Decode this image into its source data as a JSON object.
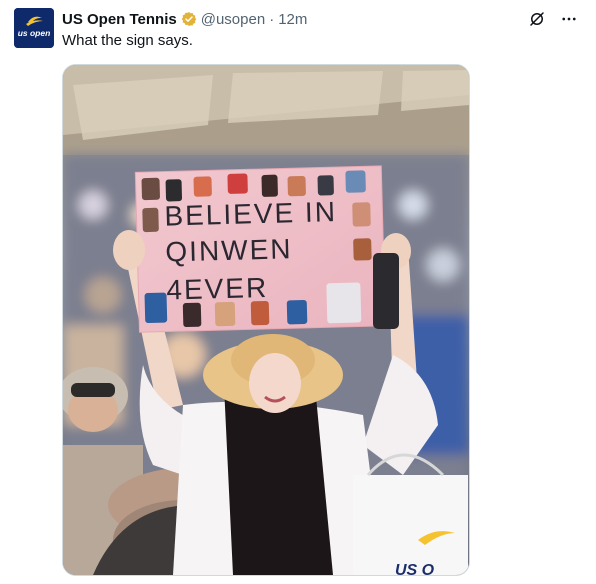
{
  "tweet": {
    "display_name": "US Open Tennis",
    "handle": "@usopen",
    "separator": "·",
    "time": "12m",
    "text": "What the sign says.",
    "avatar_logo_text": "us open",
    "verified_badge_color": "#e2b33a",
    "avatar_color": "#0f2a6b"
  },
  "media": {
    "sign_lines": [
      "BELIEVE  IN",
      "QINWEN",
      "4EVER"
    ],
    "bag_logo_text": "US O"
  },
  "icons": {
    "verified": "verified-badge-icon",
    "grok": "grok-icon",
    "more": "more-icon"
  }
}
